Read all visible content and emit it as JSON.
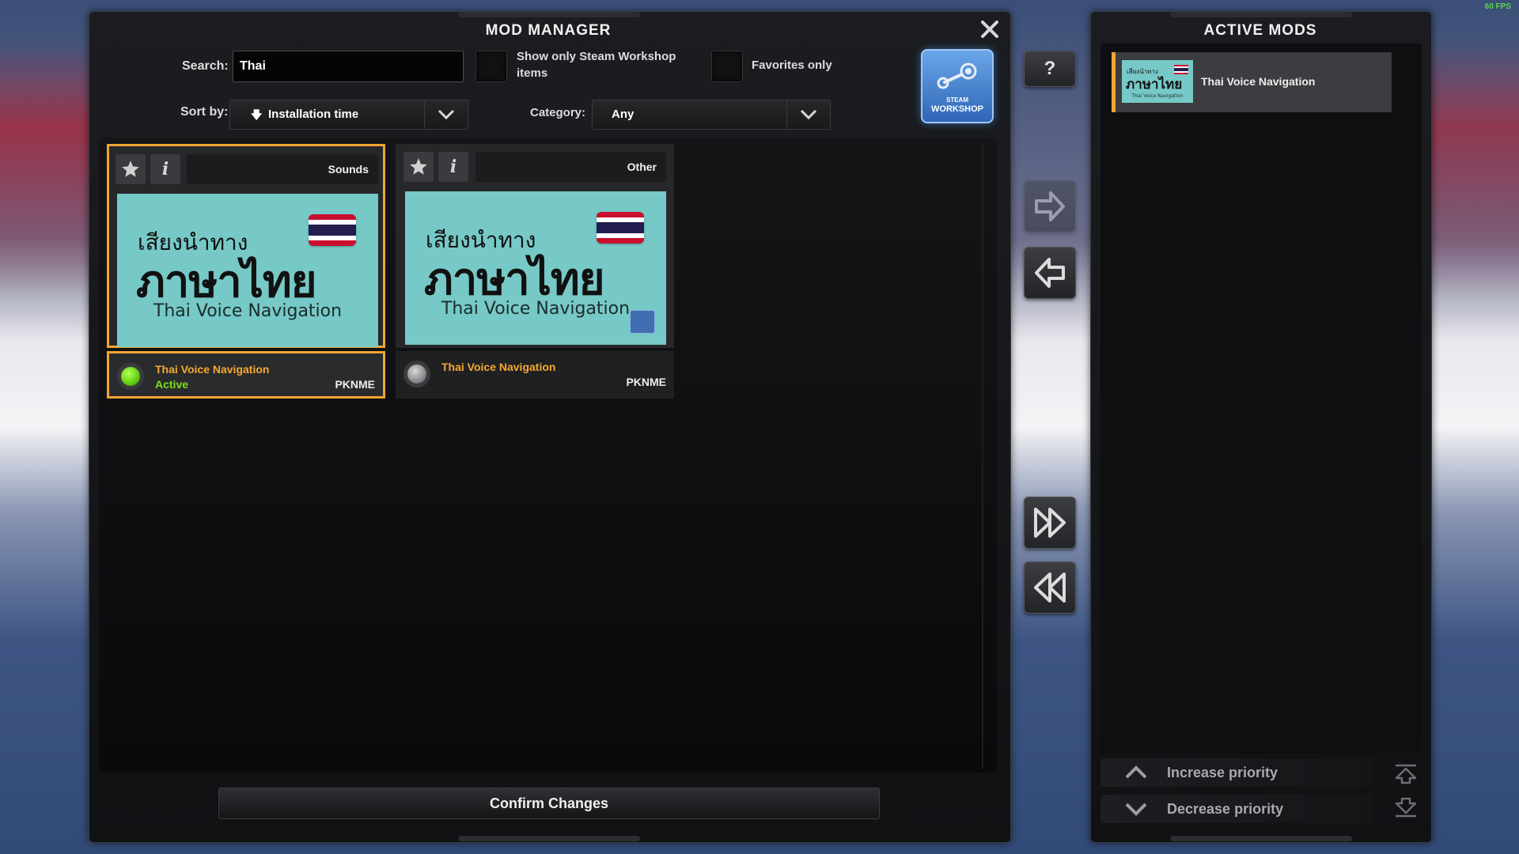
{
  "fps": "60 FPS",
  "mod_manager": {
    "title": "MOD MANAGER",
    "search_label": "Search:",
    "search_value": "Thai",
    "steam_only_label_line1": "Show only Steam Workshop",
    "steam_only_label_line2": "items",
    "favorites_label": "Favorites only",
    "sort_label": "Sort by:",
    "sort_value": "Installation time",
    "category_label": "Category:",
    "category_value": "Any",
    "workshop_button_line1": "STEAM",
    "workshop_button_line2": "WORKSHOP",
    "confirm_label": "Confirm Changes"
  },
  "mods": [
    {
      "category": "Sounds",
      "thumb_thai_small": "เสียงนำทาง",
      "thumb_thai_big": "ภาษาไทย",
      "thumb_en": "Thai Voice Navigation",
      "name": "Thai Voice Navigation",
      "status": "Active",
      "author": "PKNME",
      "selected": true,
      "active": true
    },
    {
      "category": "Other",
      "thumb_thai_small": "เสียงนำทาง",
      "thumb_thai_big": "ภาษาไทย",
      "thumb_en": "Thai Voice Navigation",
      "name": "Thai Voice Navigation",
      "status": "",
      "author": "PKNME",
      "selected": false,
      "active": false
    }
  ],
  "active_mods": {
    "title": "ACTIVE MODS",
    "items": [
      {
        "name": "Thai Voice Navigation",
        "thumb_thai_small": "เสียงนำทาง",
        "thumb_thai_big": "ภาษาไทย",
        "thumb_en": "Thai Voice Navigation"
      }
    ],
    "increase_label": "Increase priority",
    "decrease_label": "Decrease priority"
  },
  "help_label": "?",
  "colors": {
    "accent": "#f0a532",
    "active_led": "#5fcf10",
    "inactive_led": "#8a8b8e",
    "thumb_bg": "#76c9c6"
  }
}
